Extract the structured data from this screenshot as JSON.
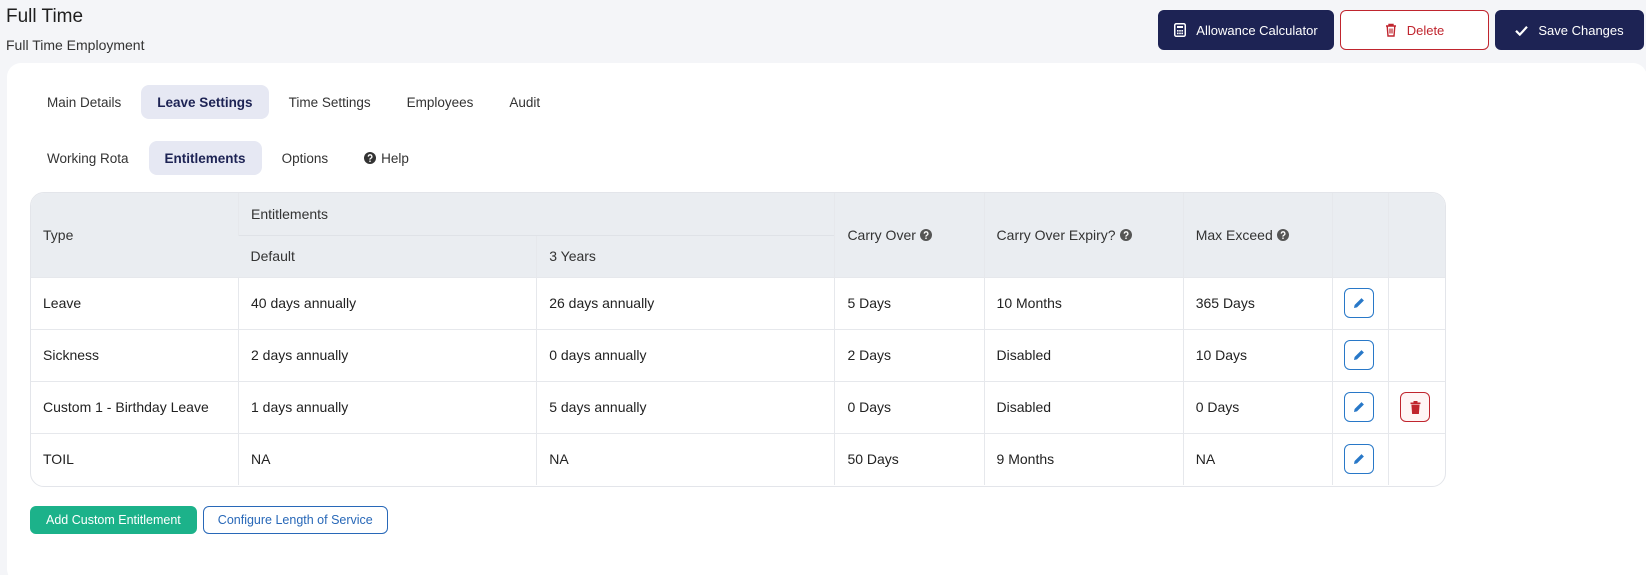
{
  "page": {
    "title": "Full Time",
    "subtitle": "Full Time Employment"
  },
  "header_actions": {
    "allowance_label": "Allowance Calculator",
    "delete_label": "Delete",
    "save_label": "Save Changes"
  },
  "main_tabs": [
    {
      "label": "Main Details",
      "active": false
    },
    {
      "label": "Leave Settings",
      "active": true
    },
    {
      "label": "Time Settings",
      "active": false
    },
    {
      "label": "Employees",
      "active": false
    },
    {
      "label": "Audit",
      "active": false
    }
  ],
  "sub_tabs": [
    {
      "label": "Working Rota",
      "active": false
    },
    {
      "label": "Entitlements",
      "active": true
    },
    {
      "label": "Options",
      "active": false
    },
    {
      "label": "Help",
      "active": false,
      "icon": "question-circle-icon"
    }
  ],
  "table": {
    "headers": {
      "type": "Type",
      "entitlements": "Entitlements",
      "default": "Default",
      "three_years": "3 Years",
      "carry_over": "Carry Over",
      "carry_over_expiry": "Carry Over Expiry?",
      "max_exceed": "Max Exceed"
    },
    "rows": [
      {
        "type": "Leave",
        "default": "40 days annually",
        "three_years": "26 days annually",
        "carry_over": "5 Days",
        "carry_over_expiry": "10 Months",
        "max_exceed": "365 Days",
        "deletable": false
      },
      {
        "type": "Sickness",
        "default": "2 days annually",
        "three_years": "0 days annually",
        "carry_over": "2 Days",
        "carry_over_expiry": "Disabled",
        "max_exceed": "10 Days",
        "deletable": false
      },
      {
        "type": "Custom 1 - Birthday Leave",
        "default": "1 days annually",
        "three_years": "5 days annually",
        "carry_over": "0 Days",
        "carry_over_expiry": "Disabled",
        "max_exceed": "0 Days",
        "deletable": true
      },
      {
        "type": "TOIL",
        "default": "NA",
        "three_years": "NA",
        "carry_over": "50 Days",
        "carry_over_expiry": "9 Months",
        "max_exceed": "NA",
        "deletable": false
      }
    ]
  },
  "footer_actions": {
    "add_label": "Add Custom Entitlement",
    "configure_label": "Configure Length of Service"
  },
  "colors": {
    "primary": "#1d2354",
    "danger": "#c0252e",
    "success": "#1cb28a",
    "link": "#2868b8"
  }
}
